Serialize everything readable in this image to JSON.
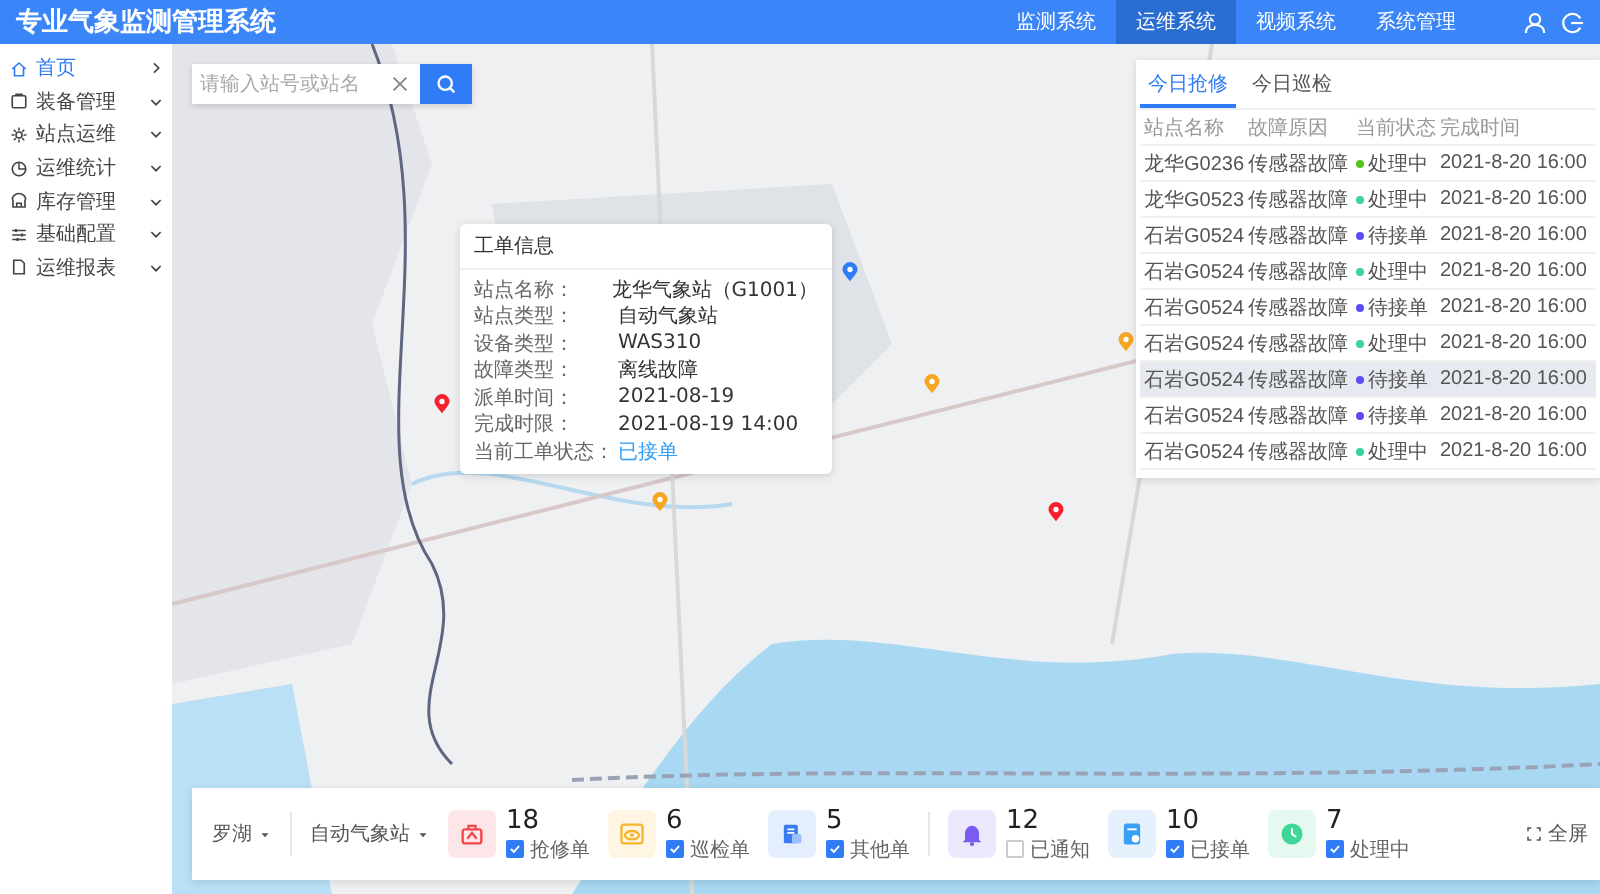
{
  "header": {
    "title": "专业气象监测管理系统",
    "nav": [
      {
        "label": "监测系统",
        "selected": false
      },
      {
        "label": "运维系统",
        "selected": true
      },
      {
        "label": "视频系统",
        "selected": false
      },
      {
        "label": "系统管理",
        "selected": false
      }
    ]
  },
  "sidebar": {
    "items": [
      {
        "label": "首页",
        "kind": "link",
        "selected": true
      },
      {
        "label": "装备管理",
        "kind": "group",
        "selected": false
      },
      {
        "label": "站点运维",
        "kind": "group",
        "selected": false
      },
      {
        "label": "运维统计",
        "kind": "group",
        "selected": false
      },
      {
        "label": "库存管理",
        "kind": "group",
        "selected": false
      },
      {
        "label": "基础配置",
        "kind": "group",
        "selected": false
      },
      {
        "label": "运维报表",
        "kind": "group",
        "selected": false
      }
    ]
  },
  "search": {
    "placeholder": "请输入站号或站名"
  },
  "map": {
    "pins": [
      {
        "color": "#f5222d"
      },
      {
        "color": "#2f7cf6"
      },
      {
        "color": "#f5a623"
      },
      {
        "color": "#f5a623"
      },
      {
        "color": "#f5a623"
      },
      {
        "color": "#f5222d"
      }
    ]
  },
  "popup": {
    "title": "工单信息",
    "fields": [
      {
        "label": "站点名称：",
        "value": "龙华气象站（G1001）",
        "kind": "text"
      },
      {
        "label": "站点类型：",
        "value": "自动气象站",
        "kind": "text"
      },
      {
        "label": "设备类型：",
        "value": "WAS310",
        "kind": "text"
      },
      {
        "label": "故障类型：",
        "value": "离线故障",
        "kind": "text"
      },
      {
        "label": "派单时间：",
        "value": "2021-08-19",
        "kind": "text"
      },
      {
        "label": "完成时限：",
        "value": "2021-08-19 14:00",
        "kind": "text"
      },
      {
        "label": "当前工单状态：",
        "value": "已接单",
        "kind": "status"
      }
    ]
  },
  "panel": {
    "tabs": [
      {
        "label": "今日抢修",
        "selected": true
      },
      {
        "label": "今日巡检",
        "selected": false
      }
    ],
    "columns": [
      "站点名称",
      "故障原因",
      "当前状态",
      "完成时间"
    ],
    "rows": [
      {
        "station": "龙华G0236",
        "reason": "传感器故障",
        "status": "处理中",
        "color": "#52c41a",
        "time": "2021-8-20 16:00",
        "selected": false
      },
      {
        "station": "龙华G0523",
        "reason": "传感器故障",
        "status": "处理中",
        "color": "#36cfa0",
        "time": "2021-8-20 16:00",
        "selected": false
      },
      {
        "station": "石岩G0524",
        "reason": "传感器故障",
        "status": "待接单",
        "color": "#5b4cf5",
        "time": "2021-8-20 16:00",
        "selected": false
      },
      {
        "station": "石岩G0524",
        "reason": "传感器故障",
        "status": "处理中",
        "color": "#36cfa0",
        "time": "2021-8-20 16:00",
        "selected": false
      },
      {
        "station": "石岩G0524",
        "reason": "传感器故障",
        "status": "待接单",
        "color": "#5b4cf5",
        "time": "2021-8-20 16:00",
        "selected": false
      },
      {
        "station": "石岩G0524",
        "reason": "传感器故障",
        "status": "处理中",
        "color": "#36cfa0",
        "time": "2021-8-20 16:00",
        "selected": false
      },
      {
        "station": "石岩G0524",
        "reason": "传感器故障",
        "status": "待接单",
        "color": "#5b4cf5",
        "time": "2021-8-20 16:00",
        "selected": true
      },
      {
        "station": "石岩G0524",
        "reason": "传感器故障",
        "status": "待接单",
        "color": "#5b4cf5",
        "time": "2021-8-20 16:00",
        "selected": false
      },
      {
        "station": "石岩G0524",
        "reason": "传感器故障",
        "status": "处理中",
        "color": "#36cfa0",
        "time": "2021-8-20 16:00",
        "selected": false
      }
    ]
  },
  "bottom_bar": {
    "filters": [
      {
        "label": "罗湖"
      },
      {
        "label": "自动气象站"
      }
    ],
    "stats": [
      {
        "kind": "toolbox",
        "count": "18",
        "label": "抢修单",
        "checked": true,
        "color": "#f0454b"
      },
      {
        "kind": "eye",
        "count": "6",
        "label": "巡检单",
        "checked": true,
        "color": "#f7b52c"
      },
      {
        "kind": "doc",
        "count": "5",
        "label": "其他单",
        "checked": true,
        "color": "#3a7cf0"
      },
      {
        "kind": "bell",
        "count": "12",
        "label": "已通知",
        "checked": false,
        "color": "#7b5cf0"
      },
      {
        "kind": "clipboard",
        "count": "10",
        "label": "已接单",
        "checked": true,
        "color": "#3aa0f5"
      },
      {
        "kind": "clock",
        "count": "7",
        "label": "处理中",
        "checked": true,
        "color": "#3ed598"
      }
    ],
    "fullscreen": {
      "label": "全屏"
    }
  }
}
